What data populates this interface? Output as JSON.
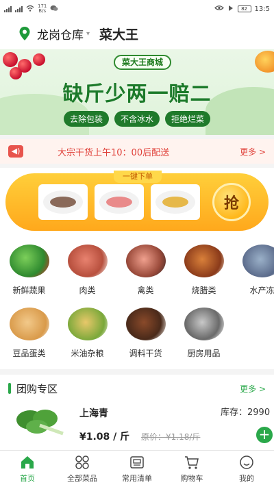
{
  "status_bar": {
    "speed_top": "171",
    "speed_bottom": "B/s",
    "battery": "82",
    "time": "13:5"
  },
  "header": {
    "warehouse": "龙岗仓库",
    "store_name": "菜大王"
  },
  "banner": {
    "tag": "菜大王商城",
    "slogan": "缺斤少两一赔二",
    "pills": [
      "去除包装",
      "不含冰水",
      "拒绝烂菜"
    ]
  },
  "notice": {
    "text": "大宗干货上午10：00后配送",
    "more": "更多 >"
  },
  "one_click": {
    "title": "一键下单",
    "grab_label": "抢"
  },
  "categories": {
    "row1": [
      "新鲜蔬果",
      "肉类",
      "禽类",
      "烧腊类",
      "水产冻"
    ],
    "row2": [
      "豆品蛋类",
      "米油杂粮",
      "调料干货",
      "厨房用品"
    ]
  },
  "group_buy": {
    "title": "团购专区",
    "more": "更多 >",
    "item": {
      "name": "上海青",
      "stock": "库存：2990",
      "price": "¥1.08 / 斤",
      "original_price": "原价：¥1.18/斤"
    }
  },
  "tabbar": {
    "tabs": [
      "首页",
      "全部菜品",
      "常用清单",
      "购物车",
      "我的"
    ],
    "active_color": "#2aa84a"
  }
}
